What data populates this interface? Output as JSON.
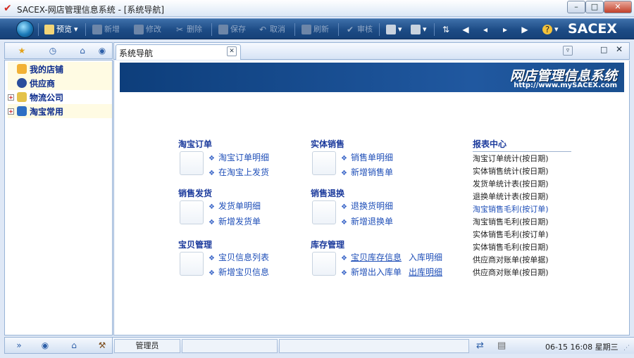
{
  "window": {
    "title": "SACEX-网店管理信息系统 - [系统导航]",
    "minimize": "–",
    "maximize": "□",
    "close": "✕"
  },
  "toolbar": {
    "preview": "预览",
    "new": "新增",
    "edit": "修改",
    "delete": "删除",
    "save": "保存",
    "cancel": "取消",
    "refresh": "刷新",
    "audit": "审核",
    "brand": "SACEX"
  },
  "left_tree": {
    "items": [
      {
        "label": "我的店铺"
      },
      {
        "label": "供应商"
      },
      {
        "label": "物流公司"
      },
      {
        "label": "淘宝常用"
      }
    ]
  },
  "doc_tab": {
    "label": "系统导航"
  },
  "banner": {
    "title": "网店管理信息系统",
    "url": "http://www.mySACEX.com"
  },
  "sections": {
    "taobao_order": {
      "title": "淘宝订单",
      "links": [
        "淘宝订单明细",
        "在淘宝上发货"
      ]
    },
    "store_sales": {
      "title": "实体销售",
      "links": [
        "销售单明细",
        "新增销售单"
      ]
    },
    "sales_ship": {
      "title": "销售发货",
      "links": [
        "发货单明细",
        "新增发货单"
      ]
    },
    "sales_return": {
      "title": "销售退换",
      "links": [
        "退换货明细",
        "新增退换单"
      ]
    },
    "item_mgmt": {
      "title": "宝贝管理",
      "links": [
        "宝贝信息列表",
        "新增宝贝信息"
      ]
    },
    "stock_mgmt": {
      "title": "库存管理",
      "links": [
        "宝贝库存信息",
        "入库明细",
        "新增出入库单",
        "出库明细"
      ]
    }
  },
  "reports": {
    "title": "报表中心",
    "items": [
      "淘宝订单统计(按日期)",
      "实体销售统计(按日期)",
      "发货单统计表(按日期)",
      "退换单统计表(按日期)",
      "淘宝销售毛利(按订单)",
      "淘宝销售毛利(按日期)",
      "实体销售毛利(按订单)",
      "实体销售毛利(按日期)",
      "供应商对账单(按单据)",
      "供应商对账单(按日期)"
    ]
  },
  "status": {
    "user": "管理员",
    "datetime": "06-15 16:08 星期三"
  }
}
